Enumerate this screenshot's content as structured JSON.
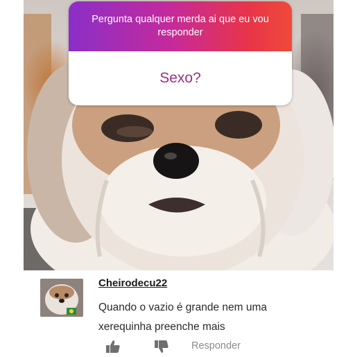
{
  "question_box": {
    "prompt": "Pergunta qualquer merda ai que eu vou responder",
    "answer": "Sexo?",
    "gradient_start": "#8a2fc8",
    "gradient_end": "#ef4a3a",
    "answer_color": "#9b2e86"
  },
  "photo": {
    "subject": "shih-tzu-dog"
  },
  "comment": {
    "username": "Cheirodecu22",
    "text": "Quando o vazio é grande nem uma xerequinha preenche mais",
    "reply_label": "Responder",
    "like_icon": "thumbs-up-icon",
    "dislike_icon": "thumbs-down-icon",
    "avatar": "dog-avatar"
  }
}
